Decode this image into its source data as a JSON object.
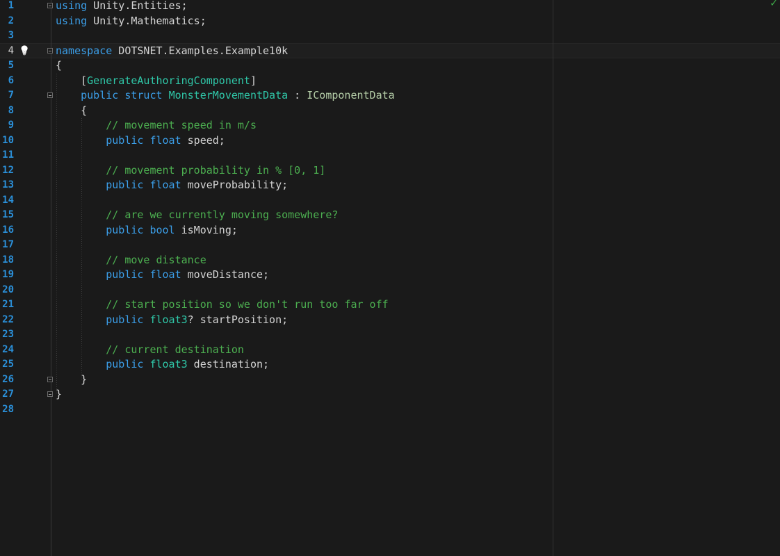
{
  "status": {
    "check_icon": "✓",
    "accent": "#3fae4a"
  },
  "colors": {
    "background": "#1a1a1a",
    "line_number": "#2b90d9",
    "keyword": "#3b9ee8",
    "type": "#2fc7a8",
    "comment": "#4caf50",
    "text": "#d4d4d4"
  },
  "editor": {
    "active_line": 4,
    "lines": [
      {
        "num": "1",
        "fold": true,
        "tokens": [
          {
            "t": "using",
            "c": "kw"
          },
          {
            "t": " Unity.Entities;",
            "c": "plain"
          }
        ]
      },
      {
        "num": "2",
        "fold": false,
        "tokens": [
          {
            "t": "using",
            "c": "kw"
          },
          {
            "t": " Unity.Mathematics;",
            "c": "plain"
          }
        ]
      },
      {
        "num": "3",
        "fold": false,
        "tokens": []
      },
      {
        "num": "4",
        "fold": true,
        "bulb": true,
        "tokens": [
          {
            "t": "namespace",
            "c": "kw"
          },
          {
            "t": " DOTSNET.Examples.Example10k",
            "c": "plain"
          }
        ]
      },
      {
        "num": "5",
        "fold": false,
        "tokens": [
          {
            "t": "{",
            "c": "plain"
          }
        ]
      },
      {
        "num": "6",
        "fold": false,
        "tokens": [
          {
            "t": "    [",
            "c": "plain"
          },
          {
            "t": "GenerateAuthoringComponent",
            "c": "attr"
          },
          {
            "t": "]",
            "c": "plain"
          }
        ]
      },
      {
        "num": "7",
        "fold": true,
        "tokens": [
          {
            "t": "    ",
            "c": "plain"
          },
          {
            "t": "public",
            "c": "kw"
          },
          {
            "t": " ",
            "c": "plain"
          },
          {
            "t": "struct",
            "c": "kw"
          },
          {
            "t": " ",
            "c": "plain"
          },
          {
            "t": "MonsterMovementData",
            "c": "type"
          },
          {
            "t": " : ",
            "c": "plain"
          },
          {
            "t": "IComponentData",
            "c": "iface"
          }
        ]
      },
      {
        "num": "8",
        "fold": false,
        "tokens": [
          {
            "t": "    {",
            "c": "plain"
          }
        ]
      },
      {
        "num": "9",
        "fold": false,
        "tokens": [
          {
            "t": "        ",
            "c": "plain"
          },
          {
            "t": "// movement speed in m/s",
            "c": "cm"
          }
        ]
      },
      {
        "num": "10",
        "fold": false,
        "tokens": [
          {
            "t": "        ",
            "c": "plain"
          },
          {
            "t": "public",
            "c": "kw"
          },
          {
            "t": " ",
            "c": "plain"
          },
          {
            "t": "float",
            "c": "kw"
          },
          {
            "t": " speed;",
            "c": "plain"
          }
        ]
      },
      {
        "num": "11",
        "fold": false,
        "tokens": []
      },
      {
        "num": "12",
        "fold": false,
        "tokens": [
          {
            "t": "        ",
            "c": "plain"
          },
          {
            "t": "// movement probability in % [0, 1]",
            "c": "cm"
          }
        ]
      },
      {
        "num": "13",
        "fold": false,
        "tokens": [
          {
            "t": "        ",
            "c": "plain"
          },
          {
            "t": "public",
            "c": "kw"
          },
          {
            "t": " ",
            "c": "plain"
          },
          {
            "t": "float",
            "c": "kw"
          },
          {
            "t": " moveProbability;",
            "c": "plain"
          }
        ]
      },
      {
        "num": "14",
        "fold": false,
        "tokens": []
      },
      {
        "num": "15",
        "fold": false,
        "tokens": [
          {
            "t": "        ",
            "c": "plain"
          },
          {
            "t": "// are we currently moving somewhere?",
            "c": "cm"
          }
        ]
      },
      {
        "num": "16",
        "fold": false,
        "tokens": [
          {
            "t": "        ",
            "c": "plain"
          },
          {
            "t": "public",
            "c": "kw"
          },
          {
            "t": " ",
            "c": "plain"
          },
          {
            "t": "bool",
            "c": "kw"
          },
          {
            "t": " isMoving;",
            "c": "plain"
          }
        ]
      },
      {
        "num": "17",
        "fold": false,
        "tokens": []
      },
      {
        "num": "18",
        "fold": false,
        "tokens": [
          {
            "t": "        ",
            "c": "plain"
          },
          {
            "t": "// move distance",
            "c": "cm"
          }
        ]
      },
      {
        "num": "19",
        "fold": false,
        "tokens": [
          {
            "t": "        ",
            "c": "plain"
          },
          {
            "t": "public",
            "c": "kw"
          },
          {
            "t": " ",
            "c": "plain"
          },
          {
            "t": "float",
            "c": "kw"
          },
          {
            "t": " moveDistance;",
            "c": "plain"
          }
        ]
      },
      {
        "num": "20",
        "fold": false,
        "tokens": []
      },
      {
        "num": "21",
        "fold": false,
        "tokens": [
          {
            "t": "        ",
            "c": "plain"
          },
          {
            "t": "// start position so we don't run too far off",
            "c": "cm"
          }
        ]
      },
      {
        "num": "22",
        "fold": false,
        "tokens": [
          {
            "t": "        ",
            "c": "plain"
          },
          {
            "t": "public",
            "c": "kw"
          },
          {
            "t": " ",
            "c": "plain"
          },
          {
            "t": "float3",
            "c": "type"
          },
          {
            "t": "? startPosition;",
            "c": "plain"
          }
        ]
      },
      {
        "num": "23",
        "fold": false,
        "tokens": []
      },
      {
        "num": "24",
        "fold": false,
        "tokens": [
          {
            "t": "        ",
            "c": "plain"
          },
          {
            "t": "// current destination",
            "c": "cm"
          }
        ]
      },
      {
        "num": "25",
        "fold": false,
        "tokens": [
          {
            "t": "        ",
            "c": "plain"
          },
          {
            "t": "public",
            "c": "kw"
          },
          {
            "t": " ",
            "c": "plain"
          },
          {
            "t": "float3",
            "c": "type"
          },
          {
            "t": " destination;",
            "c": "plain"
          }
        ]
      },
      {
        "num": "26",
        "fold": true,
        "tokens": [
          {
            "t": "    }",
            "c": "plain"
          }
        ]
      },
      {
        "num": "27",
        "fold": true,
        "tokens": [
          {
            "t": "}",
            "c": "plain"
          }
        ]
      },
      {
        "num": "28",
        "fold": false,
        "tokens": []
      }
    ]
  }
}
